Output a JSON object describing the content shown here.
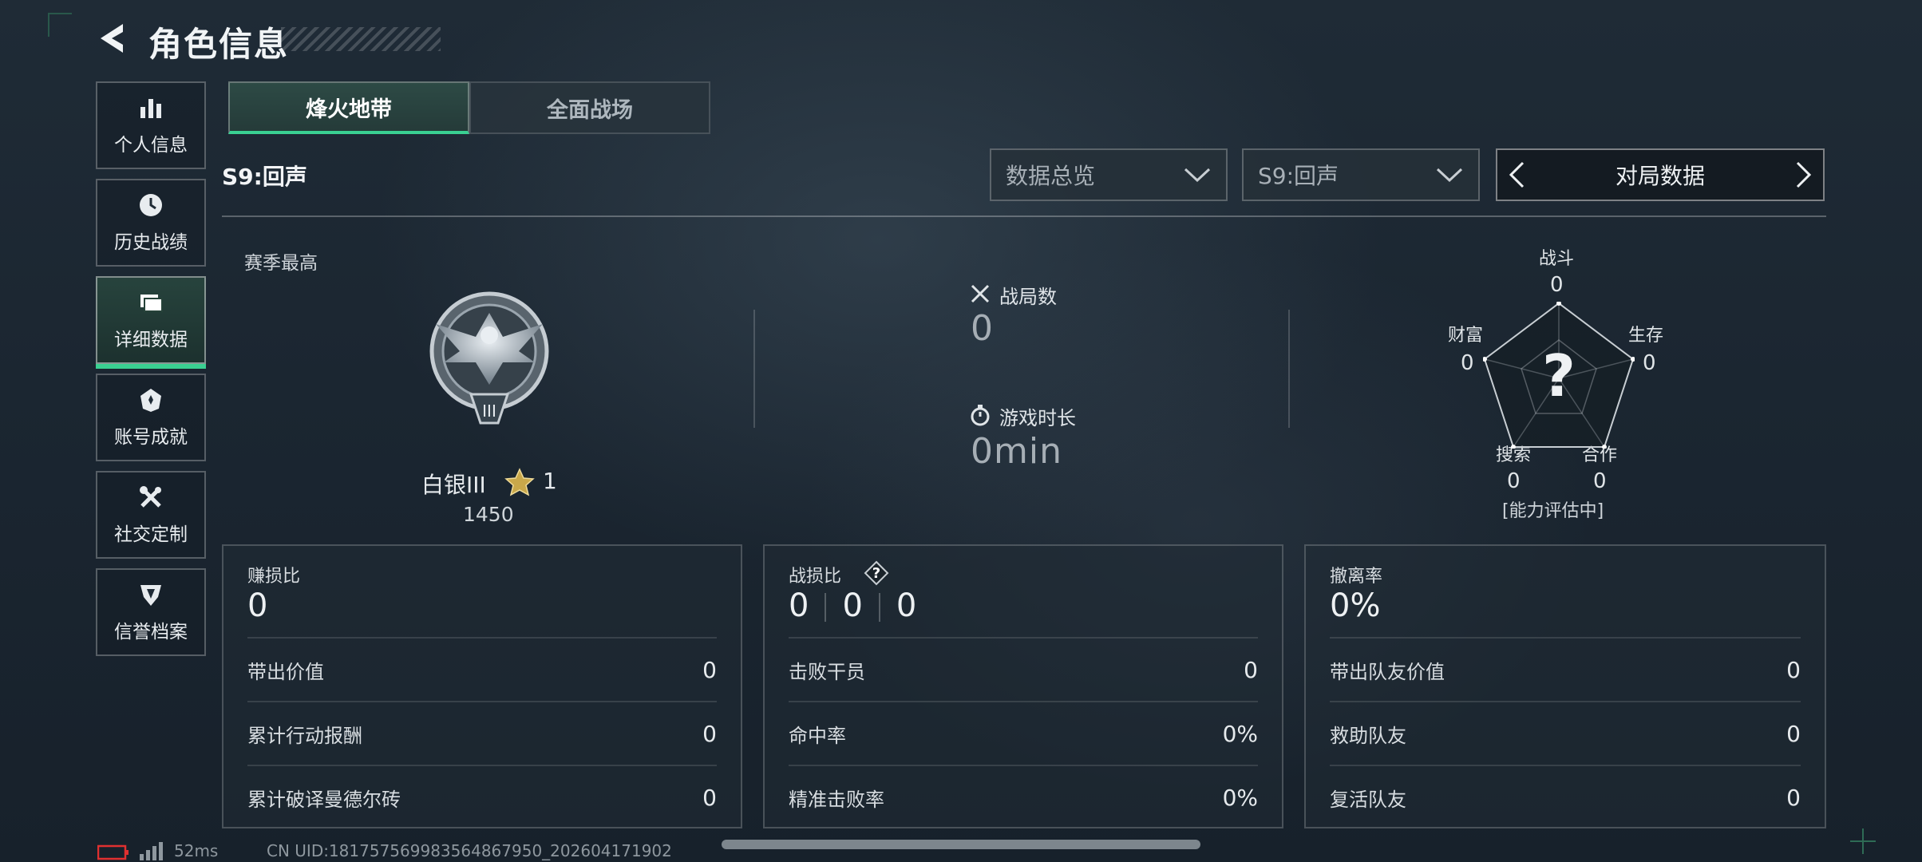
{
  "header": {
    "title": "角色信息"
  },
  "sidebar": {
    "items": [
      {
        "label": "个人信息",
        "icon": "bar-chart-icon"
      },
      {
        "label": "历史战绩",
        "icon": "clock-icon"
      },
      {
        "label": "详细数据",
        "icon": "folder-icon",
        "active": true
      },
      {
        "label": "账号成就",
        "icon": "badge-icon"
      },
      {
        "label": "社交定制",
        "icon": "tools-icon"
      },
      {
        "label": "信誉档案",
        "icon": "shield-icon"
      }
    ]
  },
  "tabs": [
    {
      "label": "烽火地带",
      "active": true
    },
    {
      "label": "全面战场",
      "active": false
    }
  ],
  "season": {
    "title": "S9:回声"
  },
  "filters": {
    "data_type": "数据总览",
    "season": "S9:回声",
    "pager_label": "对局数据"
  },
  "season_best": {
    "label": "赛季最高",
    "rank_name": "白银III",
    "stars": "1",
    "score": "1450"
  },
  "overview": {
    "matches_label": "战局数",
    "matches_value": "0",
    "playtime_label": "游戏时长",
    "playtime_value": "0min"
  },
  "radar": {
    "combat_label": "战斗",
    "combat_value": "0",
    "survival_label": "生存",
    "survival_value": "0",
    "cooperation_label": "合作",
    "cooperation_value": "0",
    "search_label": "搜索",
    "search_value": "0",
    "wealth_label": "财富",
    "wealth_value": "0",
    "center_mark": "?",
    "status": "[能力评估中]"
  },
  "cards": {
    "profit": {
      "title": "赚损比",
      "value": "0",
      "rows": [
        {
          "label": "带出价值",
          "value": "0"
        },
        {
          "label": "累计行动报酬",
          "value": "0"
        },
        {
          "label": "累计破译曼德尔砖",
          "value": "0"
        }
      ]
    },
    "kd": {
      "title": "战损比",
      "help": "?",
      "values": [
        "0",
        "0",
        "0"
      ],
      "rows": [
        {
          "label": "击败干员",
          "value": "0"
        },
        {
          "label": "命中率",
          "value": "0%"
        },
        {
          "label": "精准击败率",
          "value": "0%"
        }
      ]
    },
    "extract": {
      "title": "撤离率",
      "value": "0%",
      "rows": [
        {
          "label": "带出队友价值",
          "value": "0"
        },
        {
          "label": "救助队友",
          "value": "0"
        },
        {
          "label": "复活队友",
          "value": "0"
        }
      ]
    }
  },
  "footer": {
    "ping": "52ms",
    "uid": "CN UID:18175756998356486795​0_202604171902"
  },
  "colors": {
    "accent": "#3ad092",
    "battery_low": "#e03030"
  }
}
